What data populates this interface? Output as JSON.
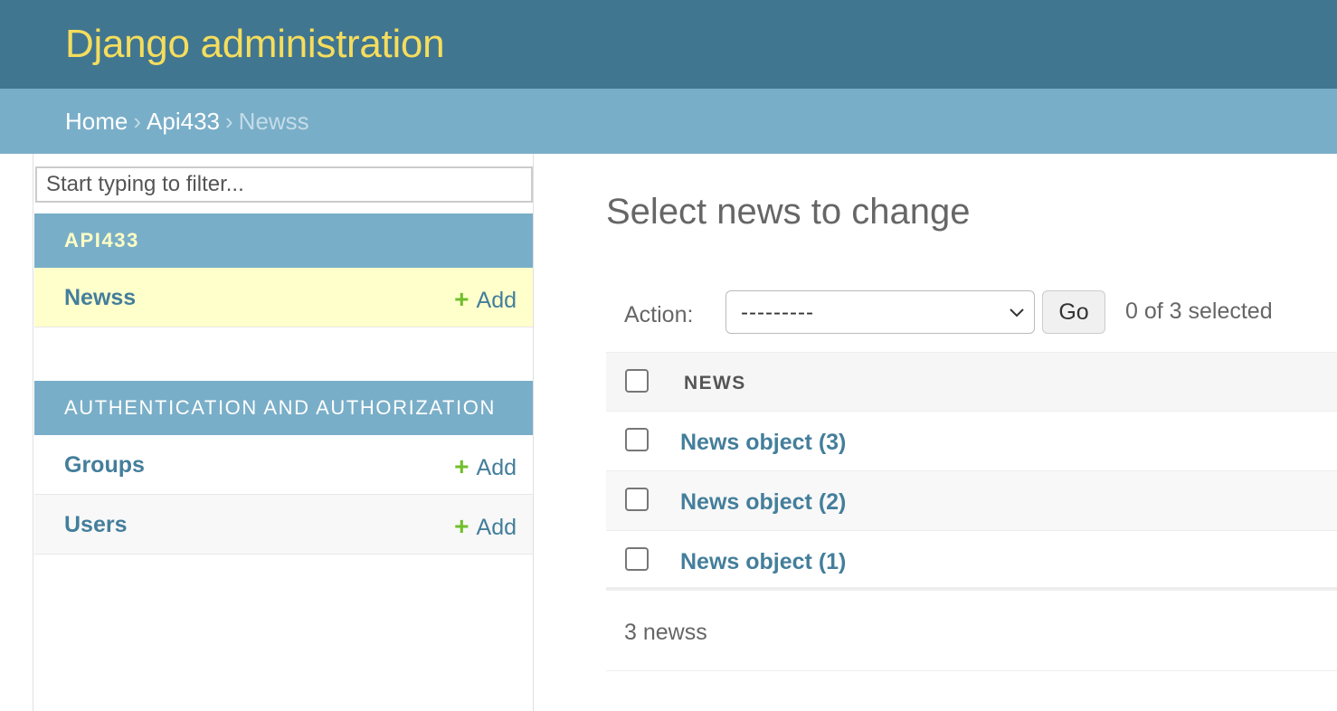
{
  "header": {
    "title": "Django administration"
  },
  "breadcrumbs": {
    "home": "Home",
    "app": "Api433",
    "current": "Newss",
    "separator": "›"
  },
  "sidebar": {
    "filter_placeholder": "Start typing to filter...",
    "modules": [
      {
        "caption": "API433",
        "rows": [
          {
            "model": "Newss",
            "add": "Add",
            "current": true
          }
        ]
      },
      {
        "caption": "AUTHENTICATION AND AUTHORIZATION",
        "rows": [
          {
            "model": "Groups",
            "add": "Add"
          },
          {
            "model": "Users",
            "add": "Add"
          }
        ]
      }
    ]
  },
  "content": {
    "title": "Select news to change",
    "actions": {
      "label": "Action:",
      "selected_option": "---------",
      "go_label": "Go",
      "counter": "0 of 3 selected"
    },
    "table": {
      "column_header": "NEWS",
      "rows": [
        "News object (3)",
        "News object (2)",
        "News object (1)"
      ]
    },
    "paginator": "3 newss"
  },
  "colors": {
    "header_bg": "#417690",
    "breadcrumb_bg": "#79aec8",
    "title_yellow": "#f5dd5d",
    "link": "#447e9b",
    "add_plus": "#70bf2b",
    "current_row": "#ffffcc"
  }
}
